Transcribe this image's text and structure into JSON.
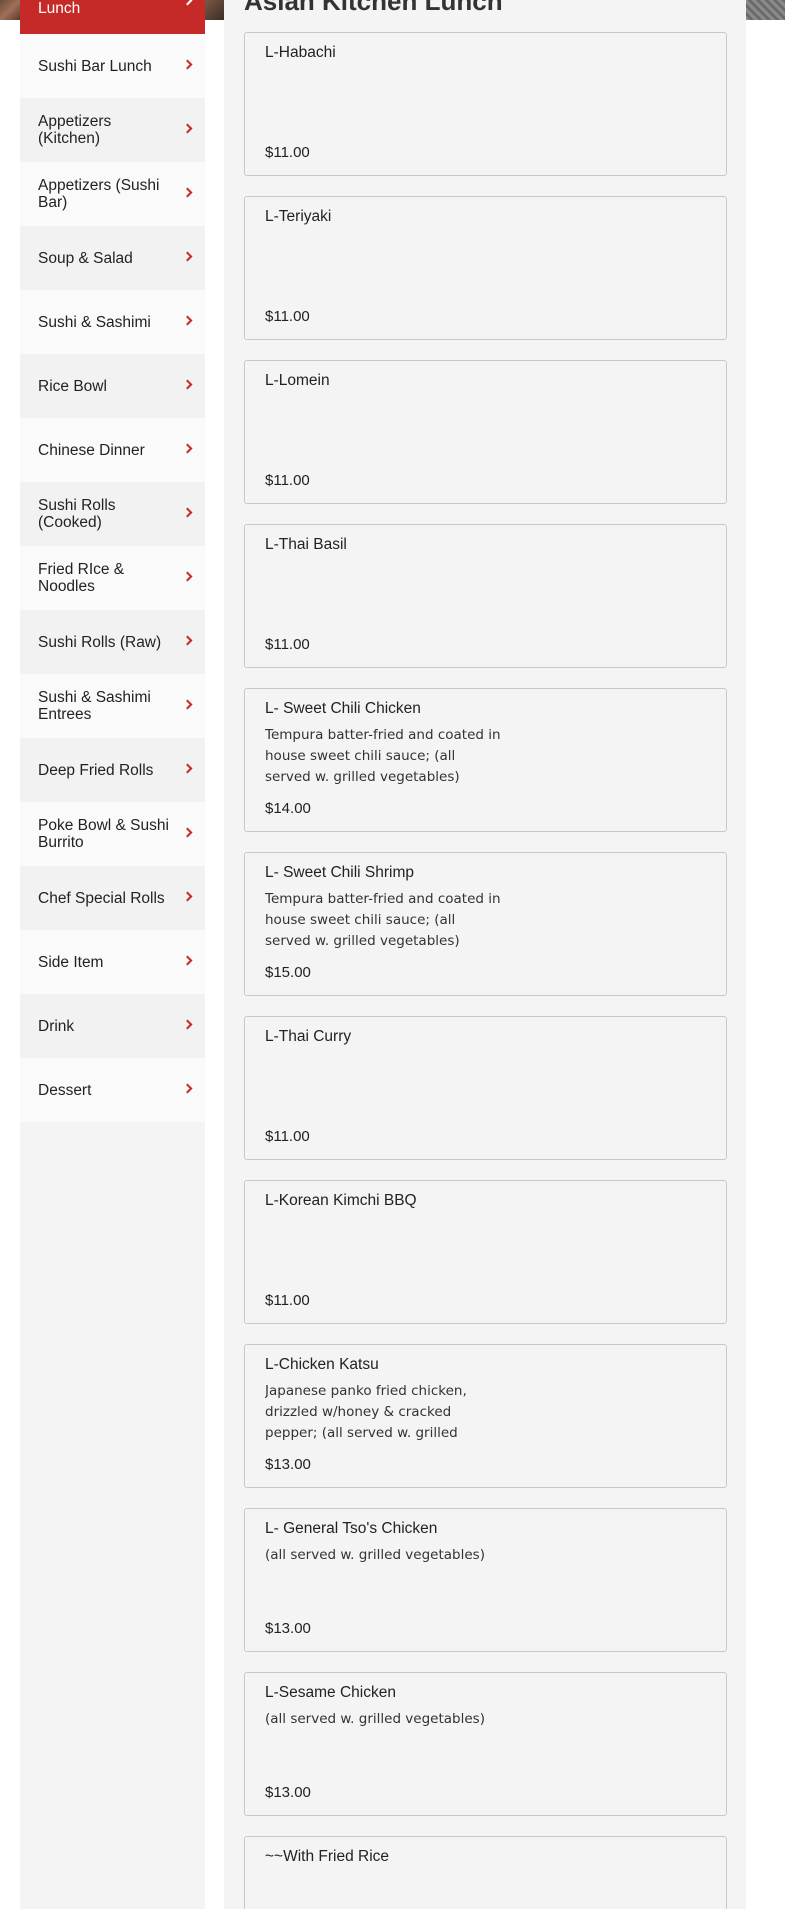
{
  "page_title": "Asian Kitchen Lunch",
  "sidebar": {
    "items": [
      {
        "label": "Lunch",
        "active": true
      },
      {
        "label": "Sushi Bar Lunch"
      },
      {
        "label": "Appetizers (Kitchen)"
      },
      {
        "label": "Appetizers (Sushi Bar)"
      },
      {
        "label": "Soup & Salad"
      },
      {
        "label": "Sushi & Sashimi"
      },
      {
        "label": "Rice Bowl"
      },
      {
        "label": "Chinese Dinner"
      },
      {
        "label": "Sushi Rolls (Cooked)"
      },
      {
        "label": "Fried RIce & Noodles"
      },
      {
        "label": "Sushi Rolls (Raw)"
      },
      {
        "label": "Sushi & Sashimi Entrees"
      },
      {
        "label": "Deep Fried Rolls"
      },
      {
        "label": "Poke Bowl & Sushi Burrito"
      },
      {
        "label": "Chef Special Rolls"
      },
      {
        "label": "Side Item"
      },
      {
        "label": "Drink"
      },
      {
        "label": "Dessert"
      }
    ]
  },
  "menu_items": [
    {
      "name": "L-Habachi",
      "description": "",
      "price": "$11.00"
    },
    {
      "name": "L-Teriyaki",
      "description": "",
      "price": "$11.00"
    },
    {
      "name": "L-Lomein",
      "description": "",
      "price": "$11.00"
    },
    {
      "name": "L-Thai Basil",
      "description": "",
      "price": "$11.00"
    },
    {
      "name": "L- Sweet Chili Chicken",
      "description": "Tempura batter-fried and coated in house sweet chili sauce; (all served w. grilled vegetables)",
      "price": "$14.00"
    },
    {
      "name": "L- Sweet Chili Shrimp",
      "description": "Tempura batter-fried and coated in house sweet chili sauce; (all served w. grilled vegetables)",
      "price": "$15.00"
    },
    {
      "name": "L-Thai Curry",
      "description": "",
      "price": "$11.00"
    },
    {
      "name": "L-Korean Kimchi BBQ",
      "description": "",
      "price": "$11.00"
    },
    {
      "name": "L-Chicken Katsu",
      "description": "Japanese panko fried chicken, drizzled w/honey & cracked pepper; (all served w. grilled",
      "price": "$13.00"
    },
    {
      "name": "L- General Tso's Chicken",
      "description": "(all served w. grilled vegetables)",
      "price": "$13.00"
    },
    {
      "name": "L-Sesame Chicken",
      "description": "(all served w. grilled vegetables)",
      "price": "$13.00"
    },
    {
      "name": "~~With Fried Rice",
      "description": "",
      "price": ""
    }
  ]
}
